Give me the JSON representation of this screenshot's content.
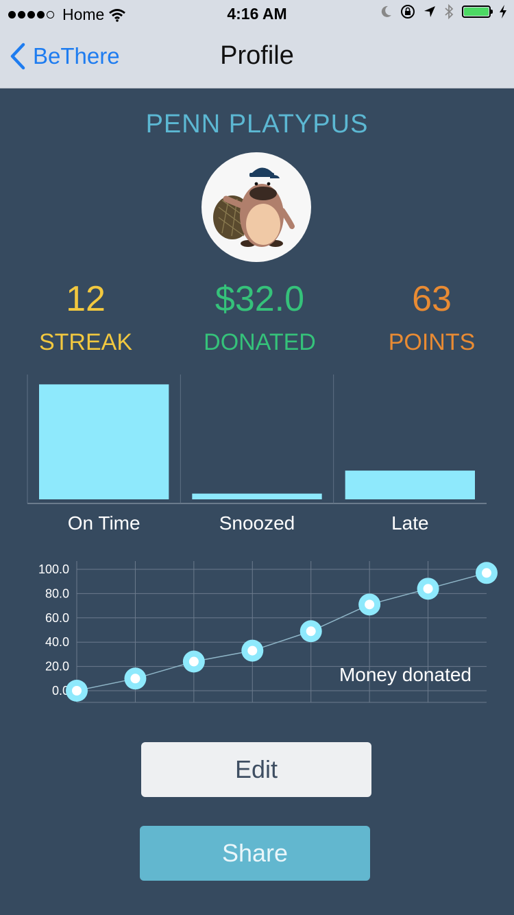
{
  "status_bar": {
    "carrier": "Home",
    "time": "4:16 AM",
    "signal_bars_filled": 4,
    "signal_bars_total": 5,
    "icons": [
      "wifi-icon",
      "moon-icon",
      "rotation-lock-icon",
      "location-arrow-icon",
      "bluetooth-icon",
      "battery-icon",
      "charging-bolt-icon"
    ],
    "battery_level": 1.0
  },
  "nav": {
    "back_label": "BeThere",
    "title": "Profile"
  },
  "profile": {
    "name": "PENN PLATYPUS",
    "avatar_icon": "platypus-avatar-icon"
  },
  "stats": {
    "streak": {
      "value": "12",
      "label": "STREAK"
    },
    "donated": {
      "value": "$32.0",
      "label": "DONATED"
    },
    "points": {
      "value": "63",
      "label": "POINTS"
    }
  },
  "colors": {
    "background": "#364a5f",
    "accent_blue": "#5cb8d3",
    "bar_fill": "#8ee9fc",
    "streak": "#f2c83f",
    "donated": "#35c27a",
    "points": "#e98b33"
  },
  "chart_data": [
    {
      "type": "bar",
      "categories": [
        "On Time",
        "Snoozed",
        "Late"
      ],
      "values": [
        1.0,
        0.05,
        0.25
      ],
      "ylim": [
        0,
        1.05
      ],
      "grid": false
    },
    {
      "type": "line",
      "x": [
        0,
        1,
        2,
        3,
        4,
        5,
        6,
        7
      ],
      "values": [
        0,
        10,
        24,
        33,
        49,
        71,
        84,
        97
      ],
      "ylim": [
        0,
        100
      ],
      "yticks": [
        "0.0",
        "20.0",
        "40.0",
        "60.0",
        "80.0",
        "100.0"
      ],
      "annotation": "Money donated",
      "grid": true
    }
  ],
  "buttons": {
    "edit": "Edit",
    "share": "Share"
  }
}
